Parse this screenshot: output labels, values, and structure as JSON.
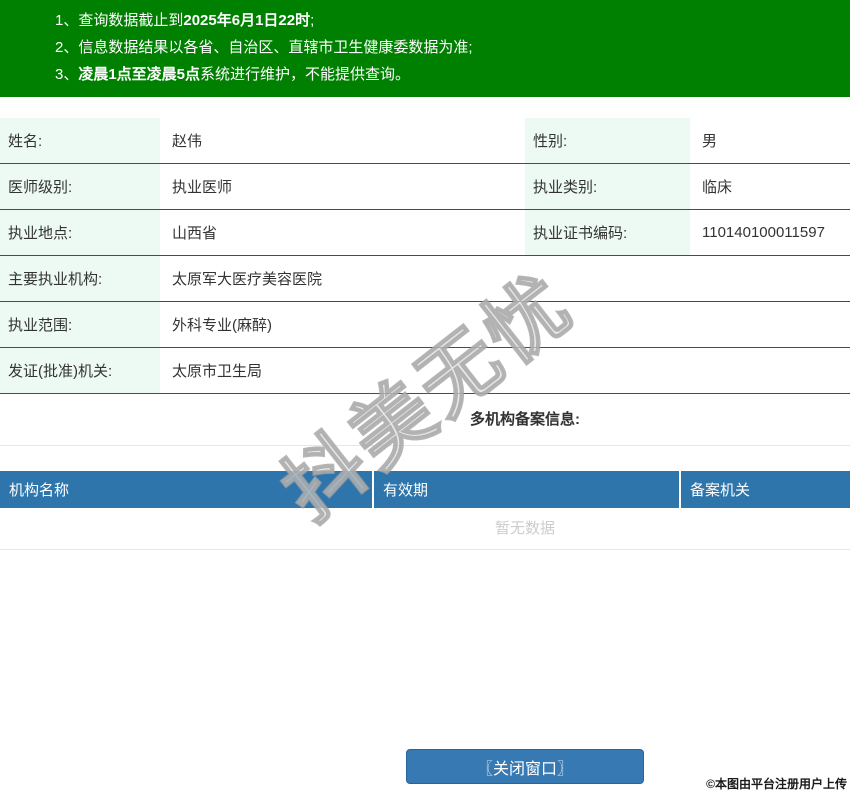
{
  "banner": {
    "line1": {
      "num": "1、",
      "pre": "查询数据截止到",
      "bold": "2025年6月1日22时",
      "post": ";"
    },
    "line2": {
      "num": "2、",
      "pre": "信息数据结果以各省、自治区、直辖市卫生健康委数据为准;",
      "bold": "",
      "post": ""
    },
    "line3": {
      "num": "3、",
      "pre": "",
      "bold": "凌晨1点至凌晨5点",
      "post": "系统进行维护，不能提供查询。"
    }
  },
  "profile": {
    "rows2col": [
      {
        "label1": "姓名:",
        "value1": "赵伟",
        "label2": "性别:",
        "value2": "男"
      },
      {
        "label1": "医师级别:",
        "value1": "执业医师",
        "label2": "执业类别:",
        "value2": "临床"
      },
      {
        "label1": "执业地点:",
        "value1": "山西省",
        "label2": "执业证书编码:",
        "value2": "110140100011597"
      }
    ],
    "rowsFull": [
      {
        "label": "主要执业机构:",
        "value": "太原军大医疗美容医院"
      },
      {
        "label": "执业范围:",
        "value": "外科专业(麻醉)"
      },
      {
        "label": "发证(批准)机关:",
        "value": "太原市卫生局"
      }
    ]
  },
  "multiOrg": {
    "heading": "多机构备案信息:",
    "columns": [
      "机构名称",
      "有效期",
      "备案机关"
    ],
    "empty": "暂无数据"
  },
  "closeButton": {
    "label": "〖关闭窗口〗"
  },
  "watermark": {
    "text": "抖美无忧"
  },
  "attribution": {
    "text": "©本图由平台注册用户上传"
  },
  "colors": {
    "bannerGreen": "#008000",
    "rowBorderGreen": "#076e48",
    "labelMint": "#edfaf4",
    "headerBlue": "#2e75ac",
    "buttonBlue": "#3779b3",
    "emptyGray": "#cccccc"
  }
}
